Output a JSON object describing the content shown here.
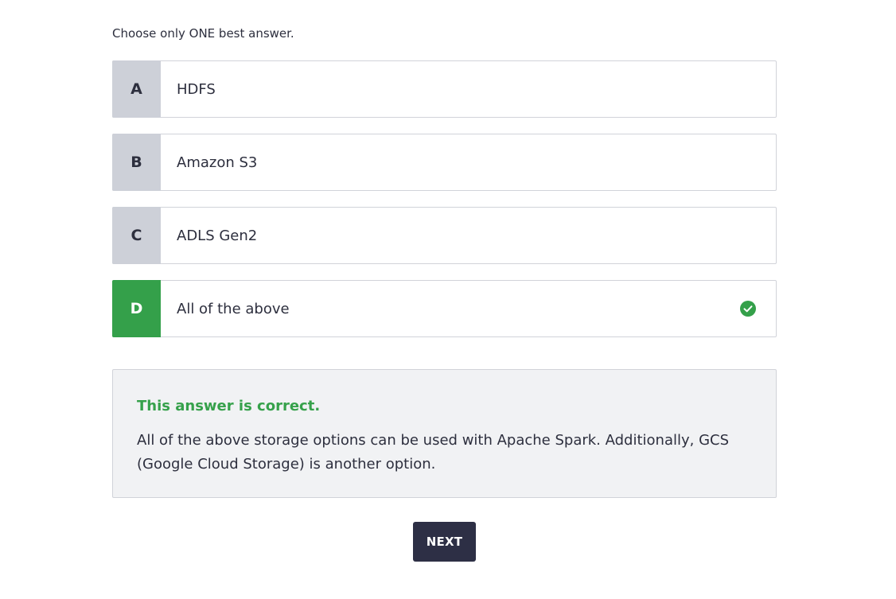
{
  "instruction": "Choose only ONE best answer.",
  "options": [
    {
      "letter": "A",
      "text": "HDFS"
    },
    {
      "letter": "B",
      "text": "Amazon S3"
    },
    {
      "letter": "C",
      "text": "ADLS Gen2"
    },
    {
      "letter": "D",
      "text": "All of the above",
      "selected": true,
      "correct": true,
      "icon": "check-circle-icon"
    }
  ],
  "feedback": {
    "title": "This answer is correct.",
    "body": "All of the above storage options can be used with Apache Spark. Additionally, GCS (Google Cloud Storage) is another option."
  },
  "next_button": {
    "label": "NEXT"
  },
  "colors": {
    "correct_green": "#34a04a",
    "letter_gray": "#cdd0d8",
    "button_dark": "#2d2f45",
    "feedback_bg": "#f1f2f4"
  }
}
